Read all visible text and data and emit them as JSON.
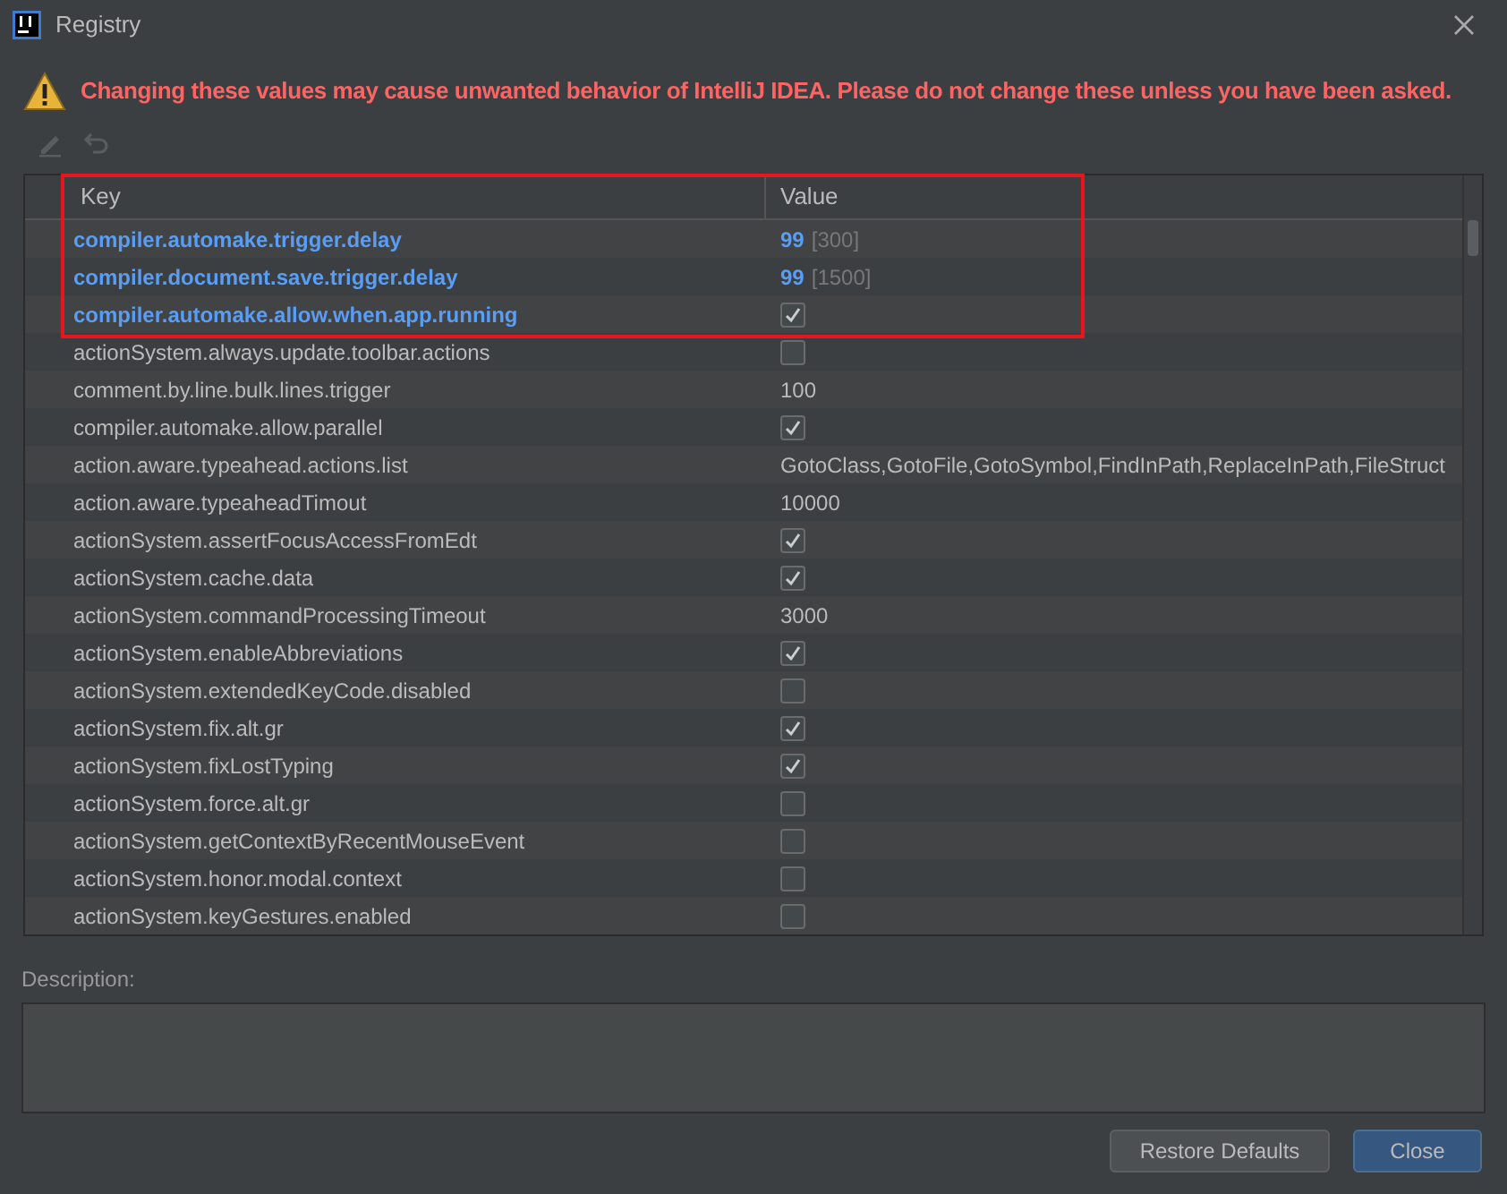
{
  "window": {
    "title": "Registry"
  },
  "warning": "Changing these values may cause unwanted behavior of IntelliJ IDEA. Please do not change these unless you have been asked.",
  "toolbar": [
    {
      "kind": "edit",
      "disabled": true
    },
    {
      "kind": "revert",
      "disabled": true
    }
  ],
  "table": {
    "columns": [
      "Key",
      "Value"
    ],
    "rows": [
      {
        "key": "compiler.automake.trigger.delay",
        "modified": true,
        "kind": "text",
        "value": "99",
        "default": "[300]"
      },
      {
        "key": "compiler.document.save.trigger.delay",
        "modified": true,
        "kind": "text",
        "value": "99",
        "default": "[1500]"
      },
      {
        "key": "compiler.automake.allow.when.app.running",
        "modified": true,
        "kind": "checkbox",
        "checked": true
      },
      {
        "key": "actionSystem.always.update.toolbar.actions",
        "modified": false,
        "kind": "checkbox",
        "checked": false
      },
      {
        "key": "comment.by.line.bulk.lines.trigger",
        "modified": false,
        "kind": "text",
        "value": "100"
      },
      {
        "key": "compiler.automake.allow.parallel",
        "modified": false,
        "kind": "checkbox",
        "checked": true
      },
      {
        "key": "action.aware.typeahead.actions.list",
        "modified": false,
        "kind": "text",
        "value": "GotoClass,GotoFile,GotoSymbol,FindInPath,ReplaceInPath,FileStruct"
      },
      {
        "key": "action.aware.typeaheadTimout",
        "modified": false,
        "kind": "text",
        "value": "10000"
      },
      {
        "key": "actionSystem.assertFocusAccessFromEdt",
        "modified": false,
        "kind": "checkbox",
        "checked": true
      },
      {
        "key": "actionSystem.cache.data",
        "modified": false,
        "kind": "checkbox",
        "checked": true
      },
      {
        "key": "actionSystem.commandProcessingTimeout",
        "modified": false,
        "kind": "text",
        "value": "3000"
      },
      {
        "key": "actionSystem.enableAbbreviations",
        "modified": false,
        "kind": "checkbox",
        "checked": true
      },
      {
        "key": "actionSystem.extendedKeyCode.disabled",
        "modified": false,
        "kind": "checkbox",
        "checked": false
      },
      {
        "key": "actionSystem.fix.alt.gr",
        "modified": false,
        "kind": "checkbox",
        "checked": true
      },
      {
        "key": "actionSystem.fixLostTyping",
        "modified": false,
        "kind": "checkbox",
        "checked": true
      },
      {
        "key": "actionSystem.force.alt.gr",
        "modified": false,
        "kind": "checkbox",
        "checked": false
      },
      {
        "key": "actionSystem.getContextByRecentMouseEvent",
        "modified": false,
        "kind": "checkbox",
        "checked": false
      },
      {
        "key": "actionSystem.honor.modal.context",
        "modified": false,
        "kind": "checkbox",
        "checked": false
      },
      {
        "key": "actionSystem.keyGestures.enabled",
        "modified": false,
        "kind": "checkbox",
        "checked": false
      }
    ]
  },
  "description": {
    "label": "Description:"
  },
  "buttons": [
    {
      "label": "Restore Defaults",
      "kind": "secondary"
    },
    {
      "label": "Close",
      "kind": "primary"
    }
  ]
}
